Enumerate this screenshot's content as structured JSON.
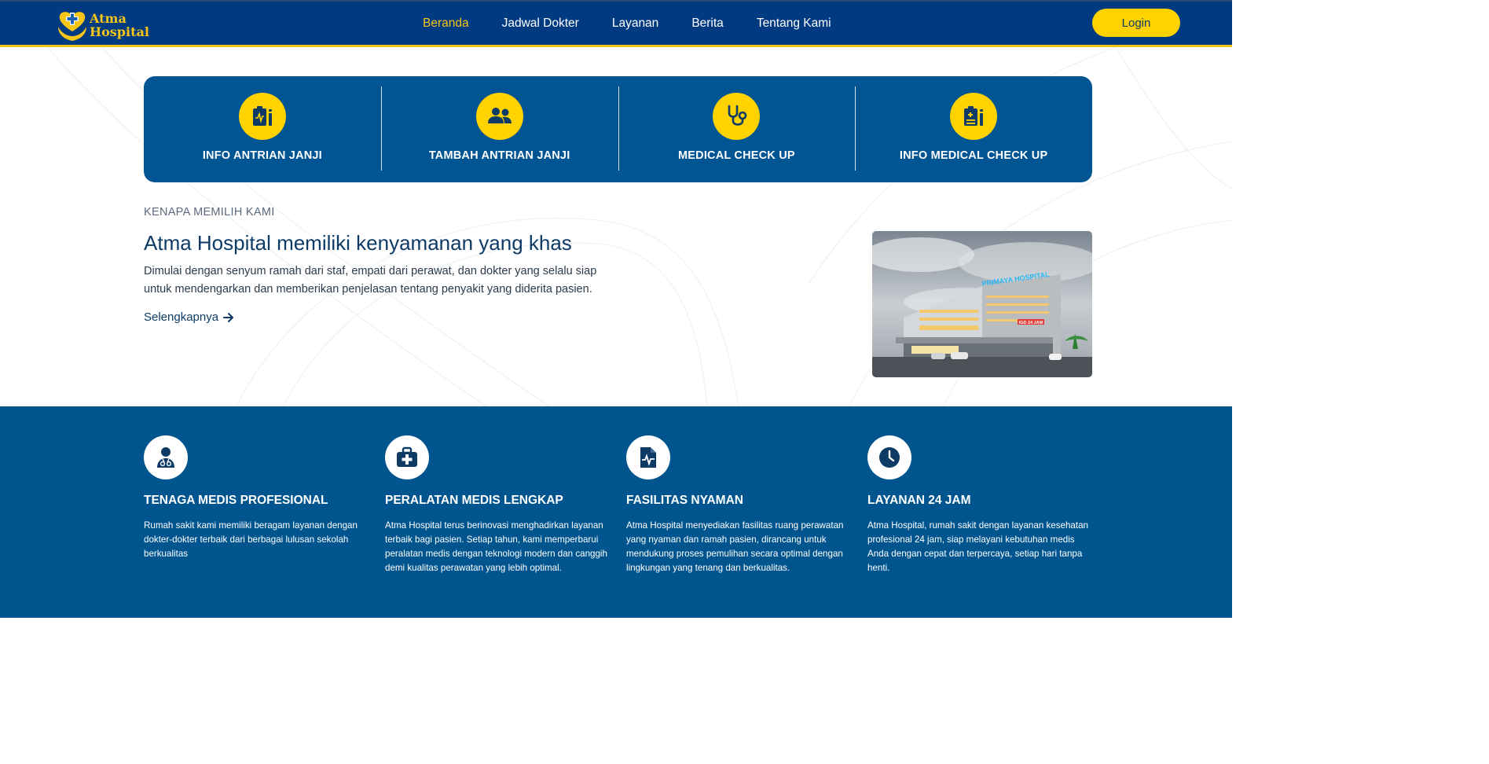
{
  "header": {
    "logo_line1": "Atma",
    "logo_line2": "Hospital",
    "nav": [
      "Beranda",
      "Jadwal Dokter",
      "Layanan",
      "Berita",
      "Tentang Kami"
    ],
    "active_nav": "Beranda",
    "login_label": "Login"
  },
  "quick_actions": [
    {
      "label": "INFO ANTRIAN JANJI",
      "icon": "clipboard-pulse-icon"
    },
    {
      "label": "TAMBAH ANTRIAN JANJI",
      "icon": "users-icon"
    },
    {
      "label": "MEDICAL CHECK UP",
      "icon": "stethoscope-icon"
    },
    {
      "label": "INFO MEDICAL CHECK UP",
      "icon": "clipboard-medical-icon"
    }
  ],
  "about": {
    "eyebrow": "KENAPA MEMILIH KAMI",
    "headline": "Atma Hospital memiliki kenyamanan yang khas",
    "lead": "Dimulai dengan senyum ramah dari staf, empati dari perawat, dan dokter yang selalu siap untuk mendengarkan dan memberikan penjelasan tentang penyakit yang diderita pasien.",
    "link_label": "Selengkapnya",
    "image_sign": "PRIMAYA HOSPITAL",
    "image_sign2": "IGD 24 JAM"
  },
  "features": [
    {
      "title": "TENAGA MEDIS PROFESIONAL",
      "icon": "doctor-icon",
      "text": "Rumah sakit kami memiliki beragam layanan dengan dokter-dokter terbaik dari berbagai lulusan sekolah berkualitas"
    },
    {
      "title": "PERALATAN MEDIS LENGKAP",
      "icon": "medical-kit-icon",
      "text": "Atma Hospital terus berinovasi menghadirkan layanan terbaik bagi pasien. Setiap tahun, kami memperbarui peralatan medis dengan teknologi modern dan canggih demi kualitas perawatan yang lebih optimal."
    },
    {
      "title": "FASILITAS NYAMAN",
      "icon": "medical-file-icon",
      "text": "Atma Hospital menyediakan fasilitas ruang perawatan yang nyaman dan ramah pasien, dirancang untuk mendukung proses pemulihan secara optimal dengan lingkungan yang tenang dan berkualitas."
    },
    {
      "title": "LAYANAN 24 JAM",
      "icon": "clock-icon",
      "text": "Atma Hospital, rumah sakit dengan layanan kesehatan profesional 24 jam, siap melayani kebutuhan medis Anda dengan cepat dan terpercaya, setiap hari tanpa henti."
    }
  ],
  "colors": {
    "header_bg": "#003a80",
    "accent_yellow": "#ffd200",
    "panel_blue": "#005592",
    "text_navy": "#0d3b66"
  }
}
